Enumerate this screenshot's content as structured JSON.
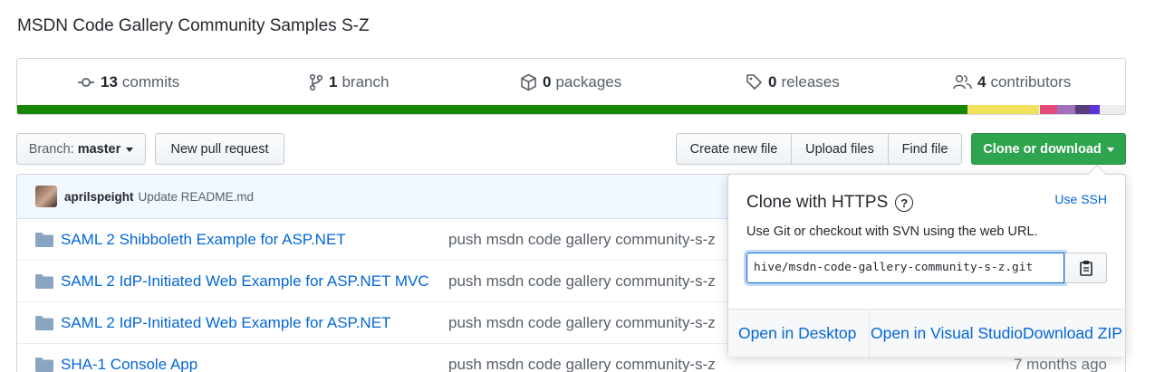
{
  "repo": {
    "description": "MSDN Code Gallery Community Samples S-Z"
  },
  "summary": {
    "stats": [
      {
        "icon": "commit-icon",
        "count": "13",
        "label": "commits"
      },
      {
        "icon": "branch-icon",
        "count": "1",
        "label": "branch"
      },
      {
        "icon": "package-icon",
        "count": "0",
        "label": "packages"
      },
      {
        "icon": "tag-icon",
        "count": "0",
        "label": "releases"
      },
      {
        "icon": "people-icon",
        "count": "4",
        "label": "contributors"
      }
    ],
    "languages": [
      {
        "color": "#178600",
        "share": 0.858
      },
      {
        "color": "#f1e05a",
        "share": 0.064
      },
      {
        "color": "#ffffff",
        "share": 0.001
      },
      {
        "color": "#e34c78",
        "share": 0.016
      },
      {
        "color": "#a270ba",
        "share": 0.016
      },
      {
        "color": "#563d7c",
        "share": 0.013
      },
      {
        "color": "#5b34da",
        "share": 0.009
      },
      {
        "color": "#ededed",
        "share": 0.023
      }
    ]
  },
  "toolbar": {
    "branch_prefix": "Branch:",
    "branch_name": "master",
    "new_pull_request": "New pull request",
    "create_new_file": "Create new file",
    "upload_files": "Upload files",
    "find_file": "Find file",
    "clone_or_download": "Clone or download"
  },
  "commit": {
    "author": "aprilspeight",
    "message": "Update README.md"
  },
  "files": [
    {
      "name": "SAML 2 Shibboleth Example for ASP.NET",
      "message": "push msdn code gallery community-s-z",
      "age": ""
    },
    {
      "name": "SAML 2 IdP-Initiated Web Example for ASP.NET MVC",
      "message": "push msdn code gallery community-s-z",
      "age": ""
    },
    {
      "name": "SAML 2 IdP-Initiated Web Example for ASP.NET",
      "message": "push msdn code gallery community-s-z",
      "age": ""
    },
    {
      "name": "SHA-1 Console App",
      "message": "push msdn code gallery community-s-z",
      "age": "7 months ago"
    }
  ],
  "clone": {
    "title": "Clone with HTTPS",
    "help": "?",
    "use_ssh": "Use SSH",
    "subtitle": "Use Git or checkout with SVN using the web URL.",
    "url": "hive/msdn-code-gallery-community-s-z.git",
    "open_desktop": "Open in Desktop",
    "open_vs": "Open in Visual Studio",
    "download_zip": "Download ZIP"
  }
}
